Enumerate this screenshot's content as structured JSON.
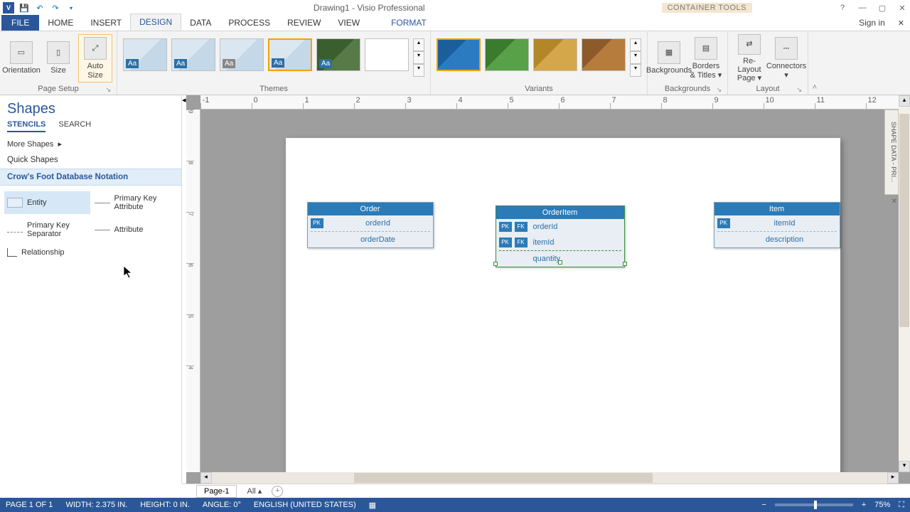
{
  "title": "Drawing1 - Visio Professional",
  "container_tools": "CONTAINER TOOLS",
  "win": {
    "help": "?",
    "min": "—",
    "max": "▢",
    "close": "✕"
  },
  "tabs": {
    "file": "FILE",
    "home": "HOME",
    "insert": "INSERT",
    "design": "DESIGN",
    "data": "DATA",
    "process": "PROCESS",
    "review": "REVIEW",
    "view": "VIEW",
    "format": "FORMAT",
    "signin": "Sign in"
  },
  "ribbon": {
    "page_setup": {
      "orientation": "Orientation",
      "size": "Size",
      "autosize": "Auto Size",
      "label": "Page Setup"
    },
    "themes": {
      "label": "Themes"
    },
    "variants": {
      "label": "Variants"
    },
    "backgrounds": {
      "bg": "Backgrounds",
      "borders": "Borders & Titles ▾",
      "label": "Backgrounds"
    },
    "layout": {
      "relayout": "Re-Layout Page ▾",
      "connectors": "Connectors ▾",
      "label": "Layout"
    }
  },
  "shapes": {
    "title": "Shapes",
    "tabs": {
      "stencils": "STENCILS",
      "search": "SEARCH"
    },
    "more": "More Shapes",
    "quick": "Quick Shapes",
    "active_stencil": "Crow's Foot Database Notation",
    "items": {
      "entity": "Entity",
      "pk_attr": "Primary Key Attribute",
      "pk_sep": "Primary Key Separator",
      "attribute": "Attribute",
      "relationship": "Relationship"
    }
  },
  "canvas": {
    "entities": {
      "order": {
        "name": "Order",
        "pk": "orderId",
        "attr": "orderDate"
      },
      "orderitem": {
        "name": "OrderItem",
        "fk1": "orderId",
        "fk2": "itemId",
        "attr": "quantity"
      },
      "item": {
        "name": "Item",
        "pk": "itemId",
        "attr": "description"
      }
    },
    "pk_tag": "PK",
    "fk_tag": "FK"
  },
  "shape_data_tab": "SHAPE DATA - PRI...",
  "page_tabs": {
    "p1": "Page-1",
    "all": "All ▴"
  },
  "status": {
    "page": "PAGE 1 OF 1",
    "width": "WIDTH: 2.375 IN.",
    "height": "HEIGHT: 0 IN.",
    "angle": "ANGLE: 0°",
    "lang": "ENGLISH (UNITED STATES)",
    "zoom": "75%",
    "minus": "−",
    "plus": "+",
    "fit": "⛶"
  }
}
